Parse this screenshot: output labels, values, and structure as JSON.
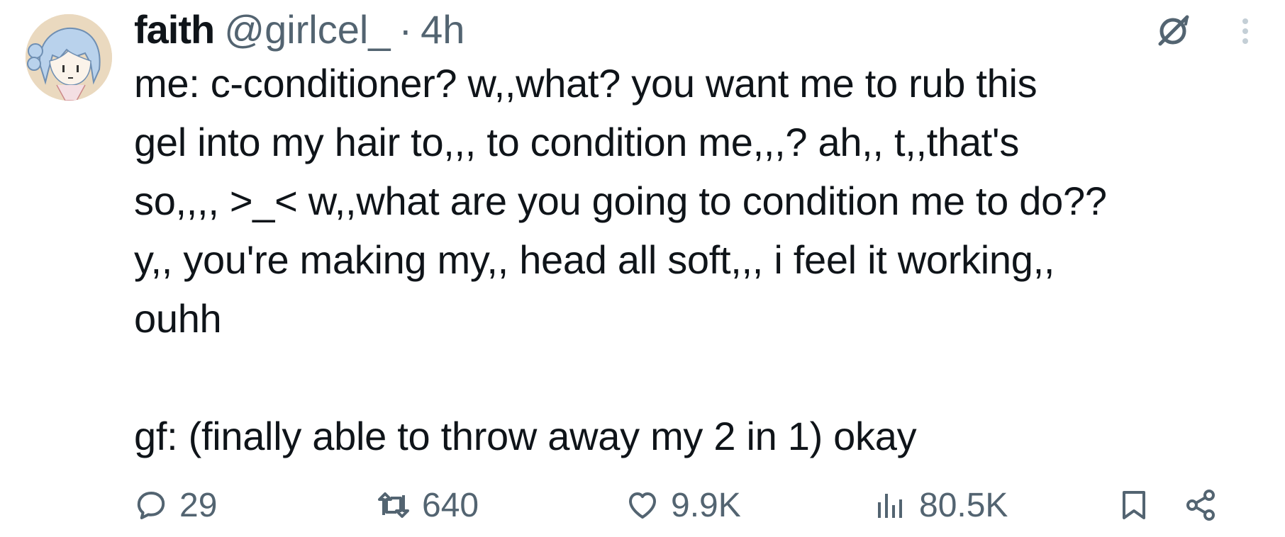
{
  "author": {
    "name": "faith",
    "handle": "@girlcel_",
    "separator": "·",
    "time": "4h"
  },
  "header_icons": [
    "grok-icon",
    "more-options-icon"
  ],
  "tweet": {
    "text": "me: c-conditioner? w,,what? you want me to rub this\ngel into my hair to,,, to condition me,,,? ah,, t,,that's\nso,,,, >_< w,,what are you going to condition me to do??\ny,, you're making my,, head all soft,,, i feel it working,,\nouhh\n\ngf: (finally able to throw away my 2 in 1) okay"
  },
  "actions": {
    "replies": "29",
    "reposts": "640",
    "likes": "9.9K",
    "views": "80.5K"
  },
  "colors": {
    "text": "#0f1419",
    "secondary": "#536471",
    "background": "#ffffff"
  }
}
